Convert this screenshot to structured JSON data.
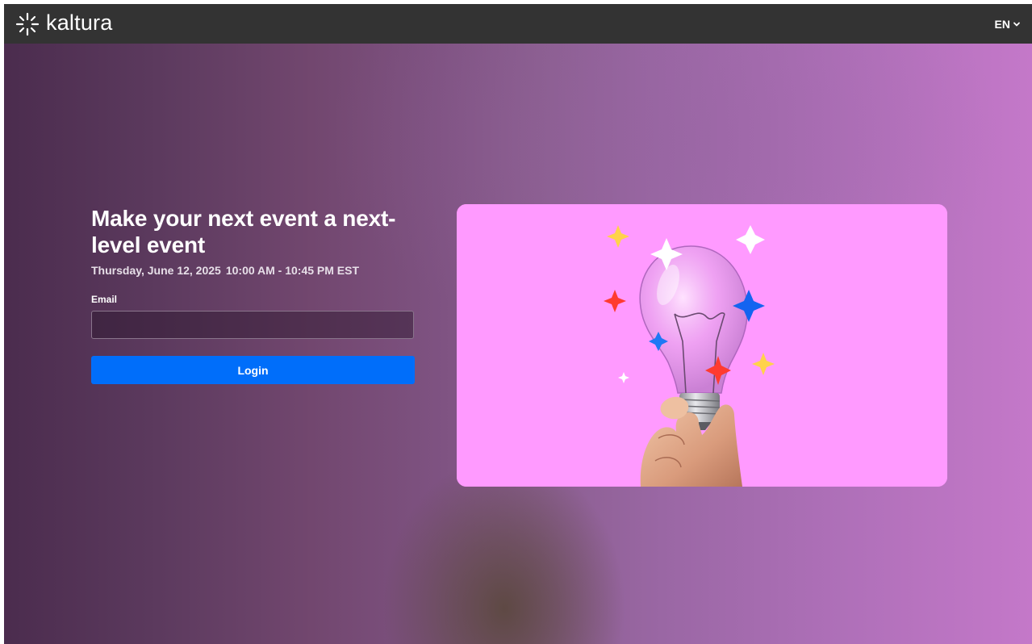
{
  "header": {
    "brand": "kaltura",
    "language": "EN"
  },
  "event": {
    "title": "Make your next event a next-level event",
    "date": "Thursday, June 12, 2025",
    "time": "10:00 AM - 10:45 PM EST"
  },
  "form": {
    "email_label": "Email",
    "email_value": "",
    "email_placeholder": "",
    "login_label": "Login"
  },
  "colors": {
    "topbar": "#333333",
    "login_button": "#006efa",
    "hero_background": "#ff9aff"
  },
  "icons": {
    "logo": "kaltura-logo-icon",
    "language": "chevron-down-icon",
    "hero": "lightbulb-illustration"
  }
}
